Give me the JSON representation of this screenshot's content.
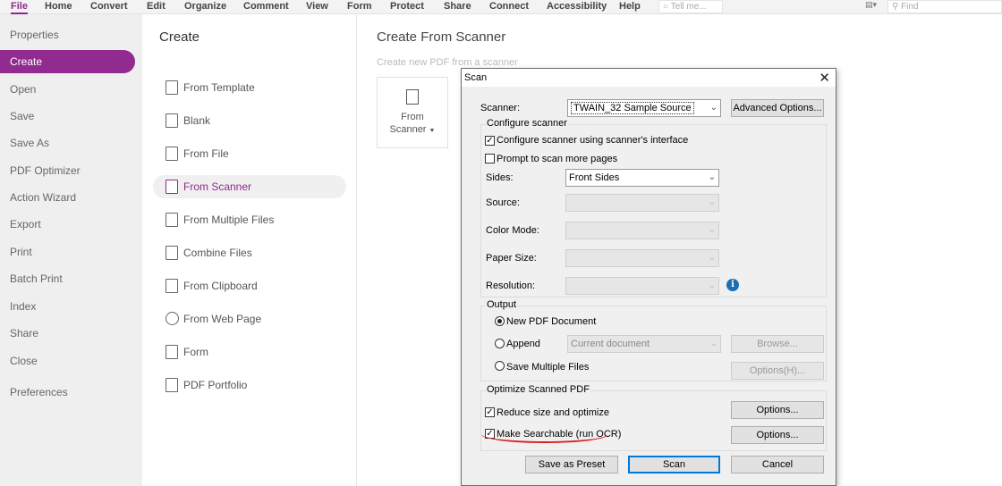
{
  "menubar": {
    "items": [
      "File",
      "Home",
      "Convert",
      "Edit",
      "Organize",
      "Comment",
      "View",
      "Form",
      "Protect",
      "Share",
      "Connect",
      "Accessibility",
      "Help"
    ],
    "tellme_placeholder": "Tell me...",
    "find_placeholder": "Find"
  },
  "sidebar": {
    "items": [
      "Properties",
      "Create",
      "Open",
      "Save",
      "Save As",
      "PDF Optimizer",
      "Action Wizard",
      "Export",
      "Print",
      "Batch Print",
      "Index",
      "Share",
      "Close",
      "Preferences"
    ],
    "active": "Create"
  },
  "create": {
    "title": "Create",
    "items": [
      "From Template",
      "Blank",
      "From File",
      "From Scanner",
      "From Multiple Files",
      "Combine Files",
      "From Clipboard",
      "From Web Page",
      "Form",
      "PDF Portfolio"
    ],
    "active": "From Scanner"
  },
  "right": {
    "title": "Create From Scanner",
    "subtitle": "Create new PDF from a scanner",
    "tile_line1": "From",
    "tile_line2": "Scanner"
  },
  "dialog": {
    "title": "Scan",
    "scanner_label": "Scanner:",
    "scanner_value": "TWAIN_32 Sample Source",
    "advanced_options": "Advanced Options...",
    "configure_group": "Configure scanner",
    "configure_interface": "Configure scanner using scanner's interface",
    "prompt_more": "Prompt to scan more pages",
    "sides_label": "Sides:",
    "sides_value": "Front Sides",
    "source_label": "Source:",
    "color_mode_label": "Color Mode:",
    "paper_size_label": "Paper Size:",
    "resolution_label": "Resolution:",
    "output_group": "Output",
    "new_pdf": "New PDF Document",
    "append": "Append",
    "append_value": "Current document",
    "browse": "Browse...",
    "save_multiple": "Save Multiple Files",
    "options_h": "Options(H)...",
    "optimize_group": "Optimize Scanned PDF",
    "reduce_size": "Reduce size and optimize",
    "make_searchable": "Make Searchable (run OCR)",
    "options_1": "Options...",
    "options_2": "Options...",
    "save_preset": "Save as Preset",
    "scan": "Scan",
    "cancel": "Cancel"
  }
}
